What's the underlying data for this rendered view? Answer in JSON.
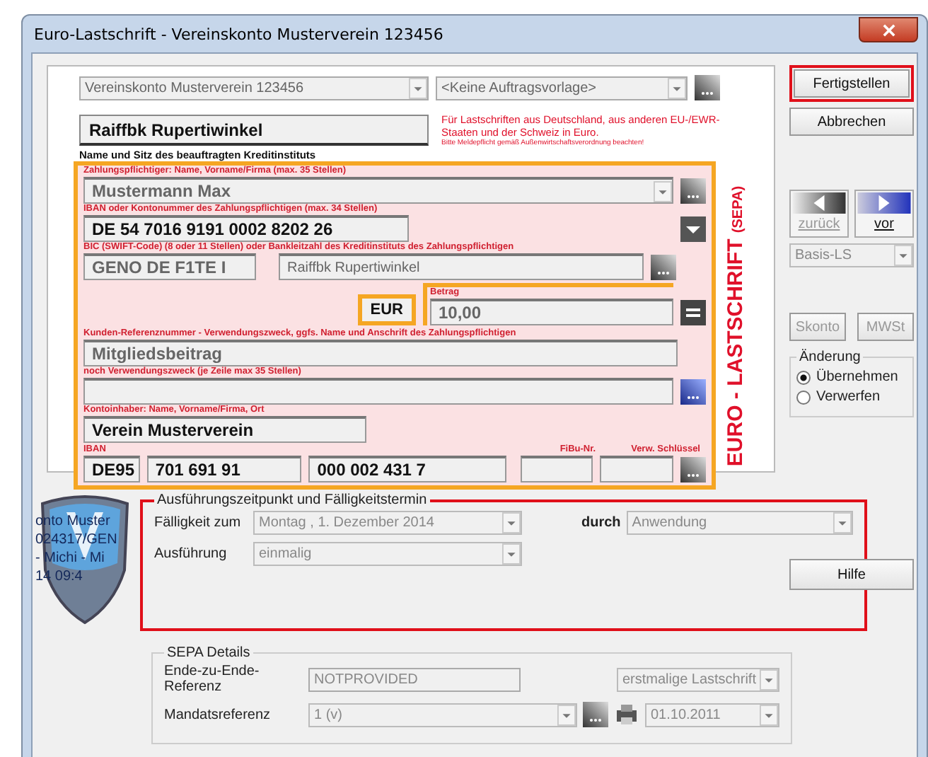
{
  "window": {
    "title": "Euro-Lastschrift - Vereinskonto Musterverein 123456"
  },
  "top": {
    "account": "Vereinskonto Musterverein 123456",
    "template": "<Keine Auftragsvorlage>",
    "bank": "Raiffbk Rupertiwinkel",
    "bank_label": "Name und Sitz des beauftragten Kreditinstituts",
    "notice": "Für Lastschriften aus Deutschland, aus anderen EU-/EWR-Staaten und der Schweiz in Euro.",
    "notice_small": "Bitte Meldepflicht gemäß Außenwirtschaftsverordnung beachten!"
  },
  "form": {
    "side_title": "EURO - LASTSCHRIFT",
    "side_sub": "(SEPA)",
    "payer_label": "Zahlungspflichtiger: Name, Vorname/Firma (max. 35 Stellen)",
    "payer": "Mustermann Max",
    "iban_label": "IBAN oder Kontonummer des Zahlungspflichtigen (max. 34 Stellen)",
    "iban": "DE 54 7016 9191 0002 8202 26",
    "bic_label": "BIC (SWIFT-Code) (8 oder 11 Stellen) oder Bankleitzahl des Kreditinstituts des Zahlungspflichtigen",
    "bic": "GENO DE F1TE I",
    "payer_bank": "Raiffbk Rupertiwinkel",
    "currency": "EUR",
    "amount_label": "Betrag",
    "amount": "10,00",
    "ref_label": "Kunden-Referenznummer - Verwendungszweck, ggfs. Name und Anschrift des Zahlungspflichtigen",
    "ref": "Mitgliedsbeitrag",
    "purpose_label": "noch Verwendungszweck (je Zeile max 35 Stellen)",
    "holder_label": "Kontoinhaber: Name, Vorname/Firma, Ort",
    "holder": "Verein Musterverein",
    "own_iban_label": "IBAN",
    "own_iban": [
      "DE95",
      "701 691 91",
      "000 002 431 7"
    ],
    "fibu_label": "FiBu-Nr.",
    "key_label": "Verw. Schlüssel"
  },
  "logo_lines": [
    "onto Muster",
    "024317/GEN",
    "- Michi - Mi",
    "14  09:4"
  ],
  "schedule": {
    "title": "Ausführungszeitpunkt und Fälligkeitstermin",
    "due_label": "Fälligkeit zum",
    "due": "Montag   ,  1. Dezember 2014",
    "by_label": "durch",
    "by": "Anwendung",
    "exec_label": "Ausführung",
    "exec": "einmalig"
  },
  "sepa": {
    "title": "SEPA Details",
    "e2e_label": "Ende-zu-Ende-Referenz",
    "e2e": "NOTPROVIDED",
    "type": "erstmalige Lastschrift",
    "mandate_label": "Mandatsreferenz",
    "mandate": "1 (v)",
    "mandate_date": "01.10.2011"
  },
  "side": {
    "finish": "Fertigstellen",
    "cancel": "Abbrechen",
    "nav": [
      {
        "label": "zurück",
        "kind": "back",
        "disabled": true
      },
      {
        "label": "vor",
        "kind": "forward",
        "disabled": false
      }
    ],
    "mode": "Basis-LS",
    "extras": [
      {
        "label": "Skonto",
        "disabled": true
      },
      {
        "label": "MWSt",
        "disabled": true
      }
    ],
    "change_title": "Änderung",
    "change_options": [
      {
        "label": "Übernehmen",
        "selected": true
      },
      {
        "label": "Verwerfen",
        "selected": false
      }
    ],
    "help": "Hilfe"
  }
}
